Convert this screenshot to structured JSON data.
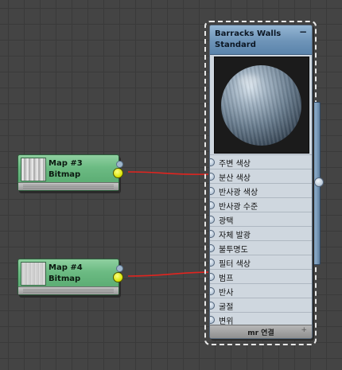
{
  "material_node": {
    "title": "Barracks Walls",
    "subtitle": "Standard",
    "minimize_icon": "minus-icon",
    "minimize_label": "−",
    "slots": [
      {
        "label": "주변 색상"
      },
      {
        "label": "분산 색상"
      },
      {
        "label": "반사광 색상"
      },
      {
        "label": "반사광 수준"
      },
      {
        "label": "광택"
      },
      {
        "label": "자체 발광"
      },
      {
        "label": "불투명도"
      },
      {
        "label": "필터 색상"
      },
      {
        "label": "범프"
      },
      {
        "label": "반사"
      },
      {
        "label": "굴절"
      },
      {
        "label": "변위"
      }
    ],
    "footer_label": "mr 연결",
    "footer_icon": "plus-icon"
  },
  "map_nodes": [
    {
      "title": "Map #3",
      "subtitle": "Bitmap",
      "connected_to": "분산 색상"
    },
    {
      "title": "Map #4",
      "subtitle": "Bitmap",
      "connected_to": "범프"
    }
  ],
  "colors": {
    "canvas": "#444444",
    "grid": "#3a3a3a",
    "map_node": "#6cbb83",
    "material_header": "#6e94b8",
    "wire": "#e2241f",
    "output_socket": "#d8e300"
  }
}
